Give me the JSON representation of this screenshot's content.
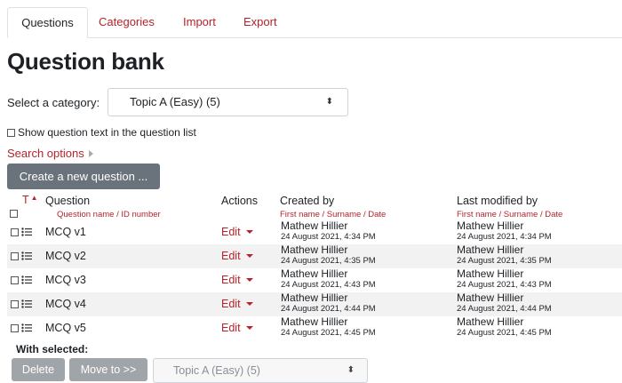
{
  "tabs": [
    {
      "label": "Questions",
      "active": true
    },
    {
      "label": "Categories",
      "active": false
    },
    {
      "label": "Import",
      "active": false
    },
    {
      "label": "Export",
      "active": false
    }
  ],
  "page_title": "Question bank",
  "category": {
    "label": "Select a category:",
    "value": "Topic A (Easy) (5)"
  },
  "show_text_label": "Show question text in the question list",
  "search_options_label": "Search options",
  "create_button": "Create a new question ...",
  "table": {
    "headers": {
      "type": "T",
      "question": "Question",
      "question_sub": "Question name / ID number",
      "actions": "Actions",
      "created": "Created by",
      "created_sub": "First name / Surname / Date",
      "modified": "Last modified by",
      "modified_sub": "First name / Surname / Date"
    },
    "rows": [
      {
        "name": "MCQ v1",
        "action": "Edit",
        "created_by": "Mathew Hillier",
        "created_date": "24 August 2021, 4:34 PM",
        "modified_by": "Mathew Hillier",
        "modified_date": "24 August 2021, 4:34 PM"
      },
      {
        "name": "MCQ v2",
        "action": "Edit",
        "created_by": "Mathew Hillier",
        "created_date": "24 August 2021, 4:35 PM",
        "modified_by": "Mathew Hillier",
        "modified_date": "24 August 2021, 4:35 PM"
      },
      {
        "name": "MCQ v3",
        "action": "Edit",
        "created_by": "Mathew Hillier",
        "created_date": "24 August 2021, 4:43 PM",
        "modified_by": "Mathew Hillier",
        "modified_date": "24 August 2021, 4:43 PM"
      },
      {
        "name": "MCQ v4",
        "action": "Edit",
        "created_by": "Mathew Hillier",
        "created_date": "24 August 2021, 4:44 PM",
        "modified_by": "Mathew Hillier",
        "modified_date": "24 August 2021, 4:44 PM"
      },
      {
        "name": "MCQ v5",
        "action": "Edit",
        "created_by": "Mathew Hillier",
        "created_date": "24 August 2021, 4:45 PM",
        "modified_by": "Mathew Hillier",
        "modified_date": "24 August 2021, 4:45 PM"
      }
    ]
  },
  "with_selected_label": "With selected:",
  "bulk": {
    "delete": "Delete",
    "move": "Move to >>",
    "target": "Topic A (Easy) (5)"
  },
  "icons": {
    "select_arrows": "up-down-arrows-icon",
    "sort": "sort-ascending-icon",
    "question_type": "multichoice-icon",
    "expand": "expand-triangle-icon",
    "dropdown": "caret-down-icon"
  },
  "colors": {
    "link": "#b5232a",
    "button": "#6a737b",
    "disabled_button": "#a0a5aa",
    "row_stripe": "#f2f2f2"
  }
}
